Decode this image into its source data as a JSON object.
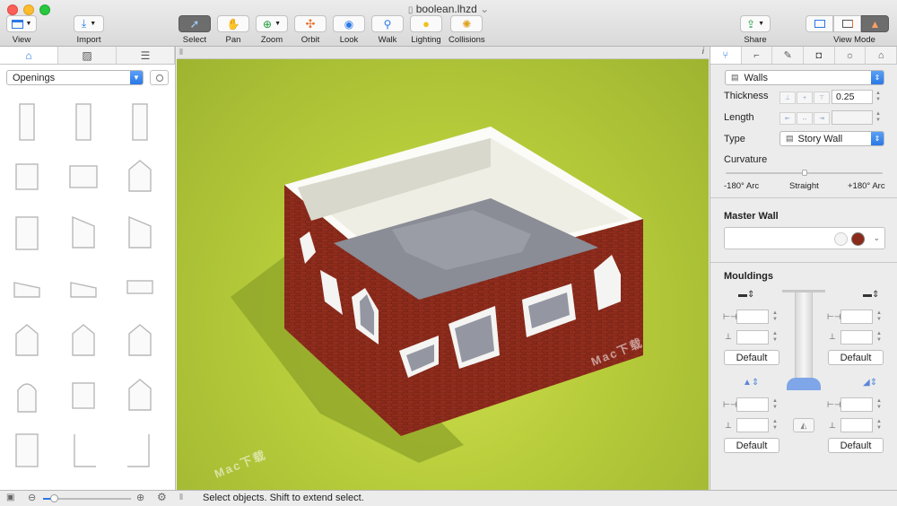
{
  "window": {
    "title": "boolean.lhzd",
    "title_caret": "⌄"
  },
  "toolbar": {
    "view": "View",
    "import": "Import",
    "select": "Select",
    "pan": "Pan",
    "zoom": "Zoom",
    "orbit": "Orbit",
    "look": "Look",
    "walk": "Walk",
    "lighting": "Lighting",
    "collisions": "Collisions",
    "share": "Share",
    "view_mode": "View Mode"
  },
  "library": {
    "category": "Openings",
    "tabs": [
      "furniture",
      "materials",
      "list"
    ],
    "thumbnails": [
      "door-tall",
      "door-tall",
      "door-tall",
      "window-square",
      "window-wide",
      "window-pentagon",
      "door-frame",
      "window-slant",
      "window-slant",
      "window-trapezoid",
      "window-trapezoid",
      "window-small",
      "window-pentagon",
      "window-pentagon",
      "window-pentagon",
      "window-arch",
      "window-square",
      "window-pentagon",
      "window-tall",
      "corner-l",
      "corner-j"
    ]
  },
  "viewport": {
    "info_icon": "i",
    "watermark": "Mac下载"
  },
  "status": {
    "message": "Select objects. Shift to extend select.",
    "zoom_fraction": 0.12
  },
  "inspector": {
    "type": "Walls",
    "thickness_label": "Thickness",
    "thickness_value": "0.25",
    "length_label": "Length",
    "length_value": "",
    "type_label": "Type",
    "type_value": "Story Wall",
    "curvature_label": "Curvature",
    "curv_left": "-180° Arc",
    "curv_mid": "Straight",
    "curv_right": "+180° Arc",
    "curvature_fraction": 0.5,
    "master_wall": "Master Wall",
    "mouldings": "Mouldings",
    "default_label": "Default",
    "colors": {
      "swatch_white": "#f4f4f4",
      "swatch_brown": "#8a2a1a"
    }
  }
}
